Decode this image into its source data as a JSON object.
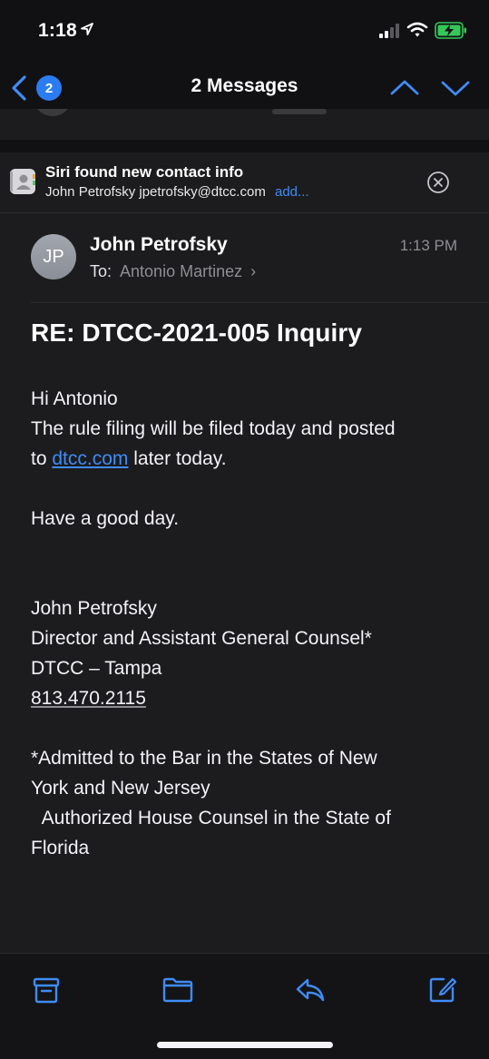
{
  "status_bar": {
    "time": "1:18",
    "icons": [
      "location-arrow-icon",
      "signal-icon",
      "wifi-icon",
      "battery-charging-icon"
    ]
  },
  "nav": {
    "unread_count": "2",
    "title": "2 Messages"
  },
  "siri": {
    "title": "Siri found new contact info",
    "info": "John Petrofsky jpetrofsky@dtcc.com",
    "add_label": "add..."
  },
  "message": {
    "avatar_initials": "JP",
    "sender": "John Petrofsky",
    "time": "1:13 PM",
    "to_label": "To:",
    "to_name": "Antonio Martinez",
    "subject": "RE: DTCC-2021-005 Inquiry",
    "greeting": "Hi Antonio",
    "line1": "The rule filing will be filed today and posted",
    "line2_prefix": "to ",
    "line2_link": "dtcc.com",
    "line2_suffix": " later today.",
    "closing": "Have a good day.",
    "sig_name": "John Petrofsky",
    "sig_title": "Director and Assistant General Counsel*",
    "sig_org": "DTCC – Tampa",
    "sig_phone": "813.470.2115",
    "disclaimer_1": "*Admitted to the Bar in the States of New",
    "disclaimer_2": "York and New Jersey",
    "disclaimer_3": "  Authorized House Counsel in the State of",
    "disclaimer_4": "Florida"
  },
  "colors": {
    "accent": "#3f8cf7",
    "background": "#1c1c1e",
    "bar": "#111113",
    "secondary_text": "#8e8e93"
  }
}
